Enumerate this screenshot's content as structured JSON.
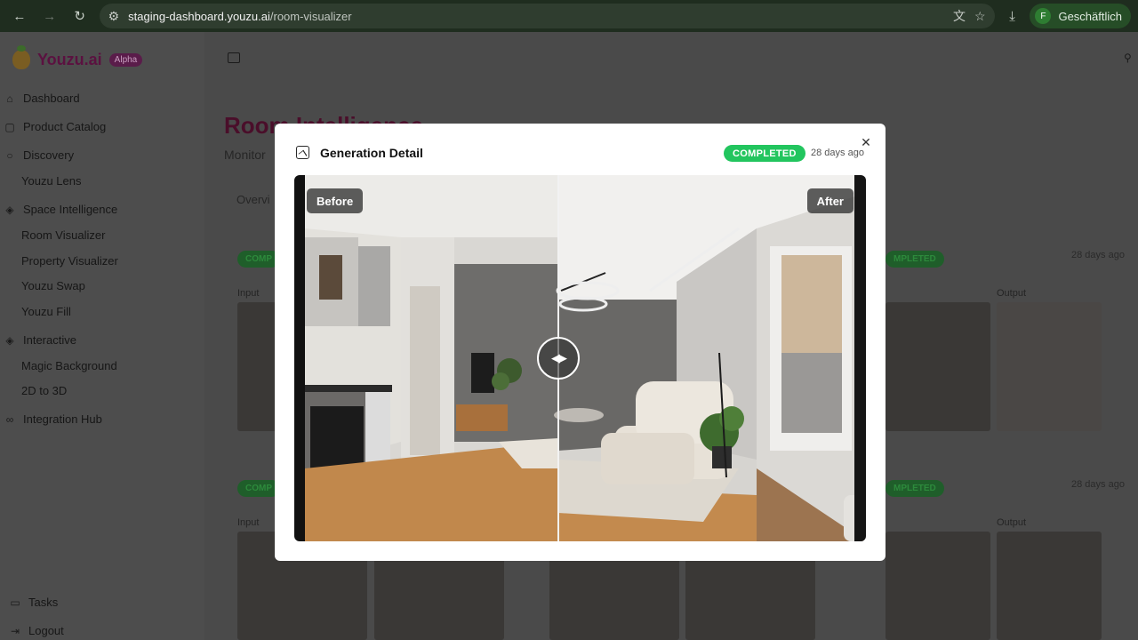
{
  "browser": {
    "url_host": "staging-dashboard.youzu.ai",
    "url_path": "/room-visualizer",
    "profile_initial": "F",
    "profile_name": "Geschäftlich"
  },
  "brand": {
    "name": "Youzu.ai",
    "badge": "Alpha"
  },
  "sidebar": {
    "items": [
      {
        "label": "Dashboard",
        "icon": "home-icon"
      },
      {
        "label": "Product Catalog",
        "icon": "bag-icon"
      },
      {
        "label": "Discovery",
        "icon": "search-icon"
      },
      {
        "label": "Youzu Lens",
        "icon": ""
      },
      {
        "label": "Space Intelligence",
        "icon": "layers-icon"
      },
      {
        "label": "Room Visualizer",
        "icon": ""
      },
      {
        "label": "Property Visualizer",
        "icon": ""
      },
      {
        "label": "Youzu Swap",
        "icon": ""
      },
      {
        "label": "Youzu Fill",
        "icon": ""
      },
      {
        "label": "Interactive",
        "icon": "layers-icon"
      },
      {
        "label": "Magic Background",
        "icon": ""
      },
      {
        "label": "2D to 3D",
        "icon": ""
      },
      {
        "label": "Integration Hub",
        "icon": "link-icon"
      }
    ],
    "footer": [
      {
        "label": "Tasks",
        "icon": "tasks-icon"
      },
      {
        "label": "Logout",
        "icon": "logout-icon"
      }
    ]
  },
  "page": {
    "title": "Room Intelligence",
    "subtitle": "Monitor",
    "tab": "Overvi"
  },
  "background_cards": {
    "badge_left": "COMP",
    "badge_right": "MPLETED",
    "time": "28 days ago",
    "input_label": "Input",
    "output_label": "Output"
  },
  "modal": {
    "title": "Generation Detail",
    "status": "COMPLETED",
    "time": "28 days ago",
    "before_label": "Before",
    "after_label": "After",
    "slider_position": 0.46
  },
  "colors": {
    "status_green": "#22c55e",
    "brand_magenta": "#5b1140"
  }
}
